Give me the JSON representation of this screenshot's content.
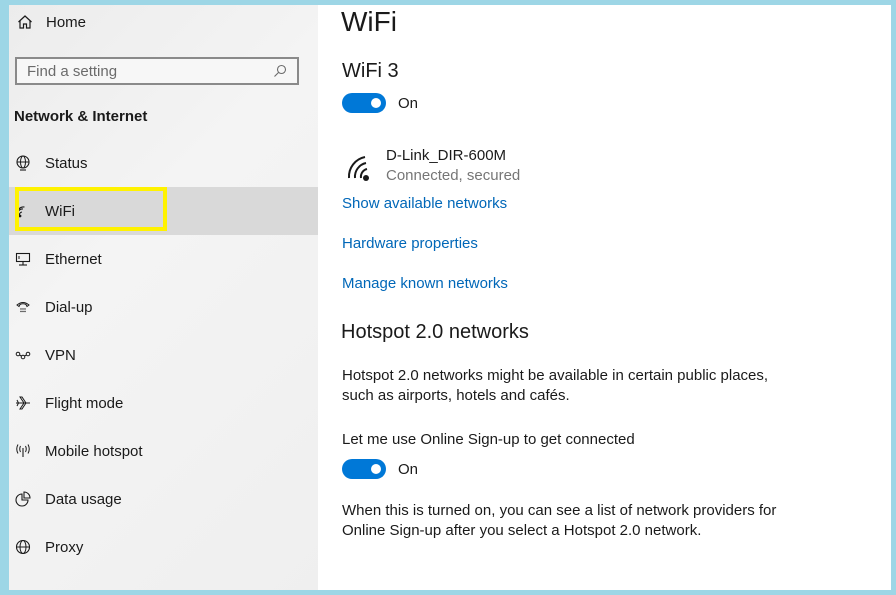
{
  "sidebar": {
    "home_label": "Home",
    "search_placeholder": "Find a setting",
    "section_title": "Network & Internet",
    "items": [
      {
        "label": "Status",
        "icon": "globe-monitor-icon"
      },
      {
        "label": "WiFi",
        "icon": "wifi-icon",
        "selected": true
      },
      {
        "label": "Ethernet",
        "icon": "ethernet-icon"
      },
      {
        "label": "Dial-up",
        "icon": "phone-icon"
      },
      {
        "label": "VPN",
        "icon": "vpn-icon"
      },
      {
        "label": "Flight mode",
        "icon": "airplane-icon"
      },
      {
        "label": "Mobile hotspot",
        "icon": "hotspot-icon"
      },
      {
        "label": "Data usage",
        "icon": "pie-chart-icon"
      },
      {
        "label": "Proxy",
        "icon": "globe-icon"
      }
    ]
  },
  "main": {
    "page_title": "WiFi",
    "adapter_title": "WiFi 3",
    "wifi_toggle": {
      "state": "On",
      "on": true
    },
    "network": {
      "name": "D-Link_DIR-600M",
      "status": "Connected, secured"
    },
    "links": [
      "Show available networks",
      "Hardware properties",
      "Manage known networks"
    ],
    "hotspot": {
      "title": "Hotspot 2.0 networks",
      "description": "Hotspot 2.0 networks might be available in certain public places, such as airports, hotels and cafés.",
      "signup_label": "Let me use Online Sign-up to get connected",
      "signup_toggle": {
        "state": "On",
        "on": true
      },
      "signup_note": "When this is turned on, you can see a list of network providers for Online Sign-up after you select a Hotspot 2.0 network."
    }
  },
  "colors": {
    "accent": "#0078d7",
    "link": "#0067b8",
    "highlight": "#fff200",
    "frame": "#9dd6e6"
  }
}
